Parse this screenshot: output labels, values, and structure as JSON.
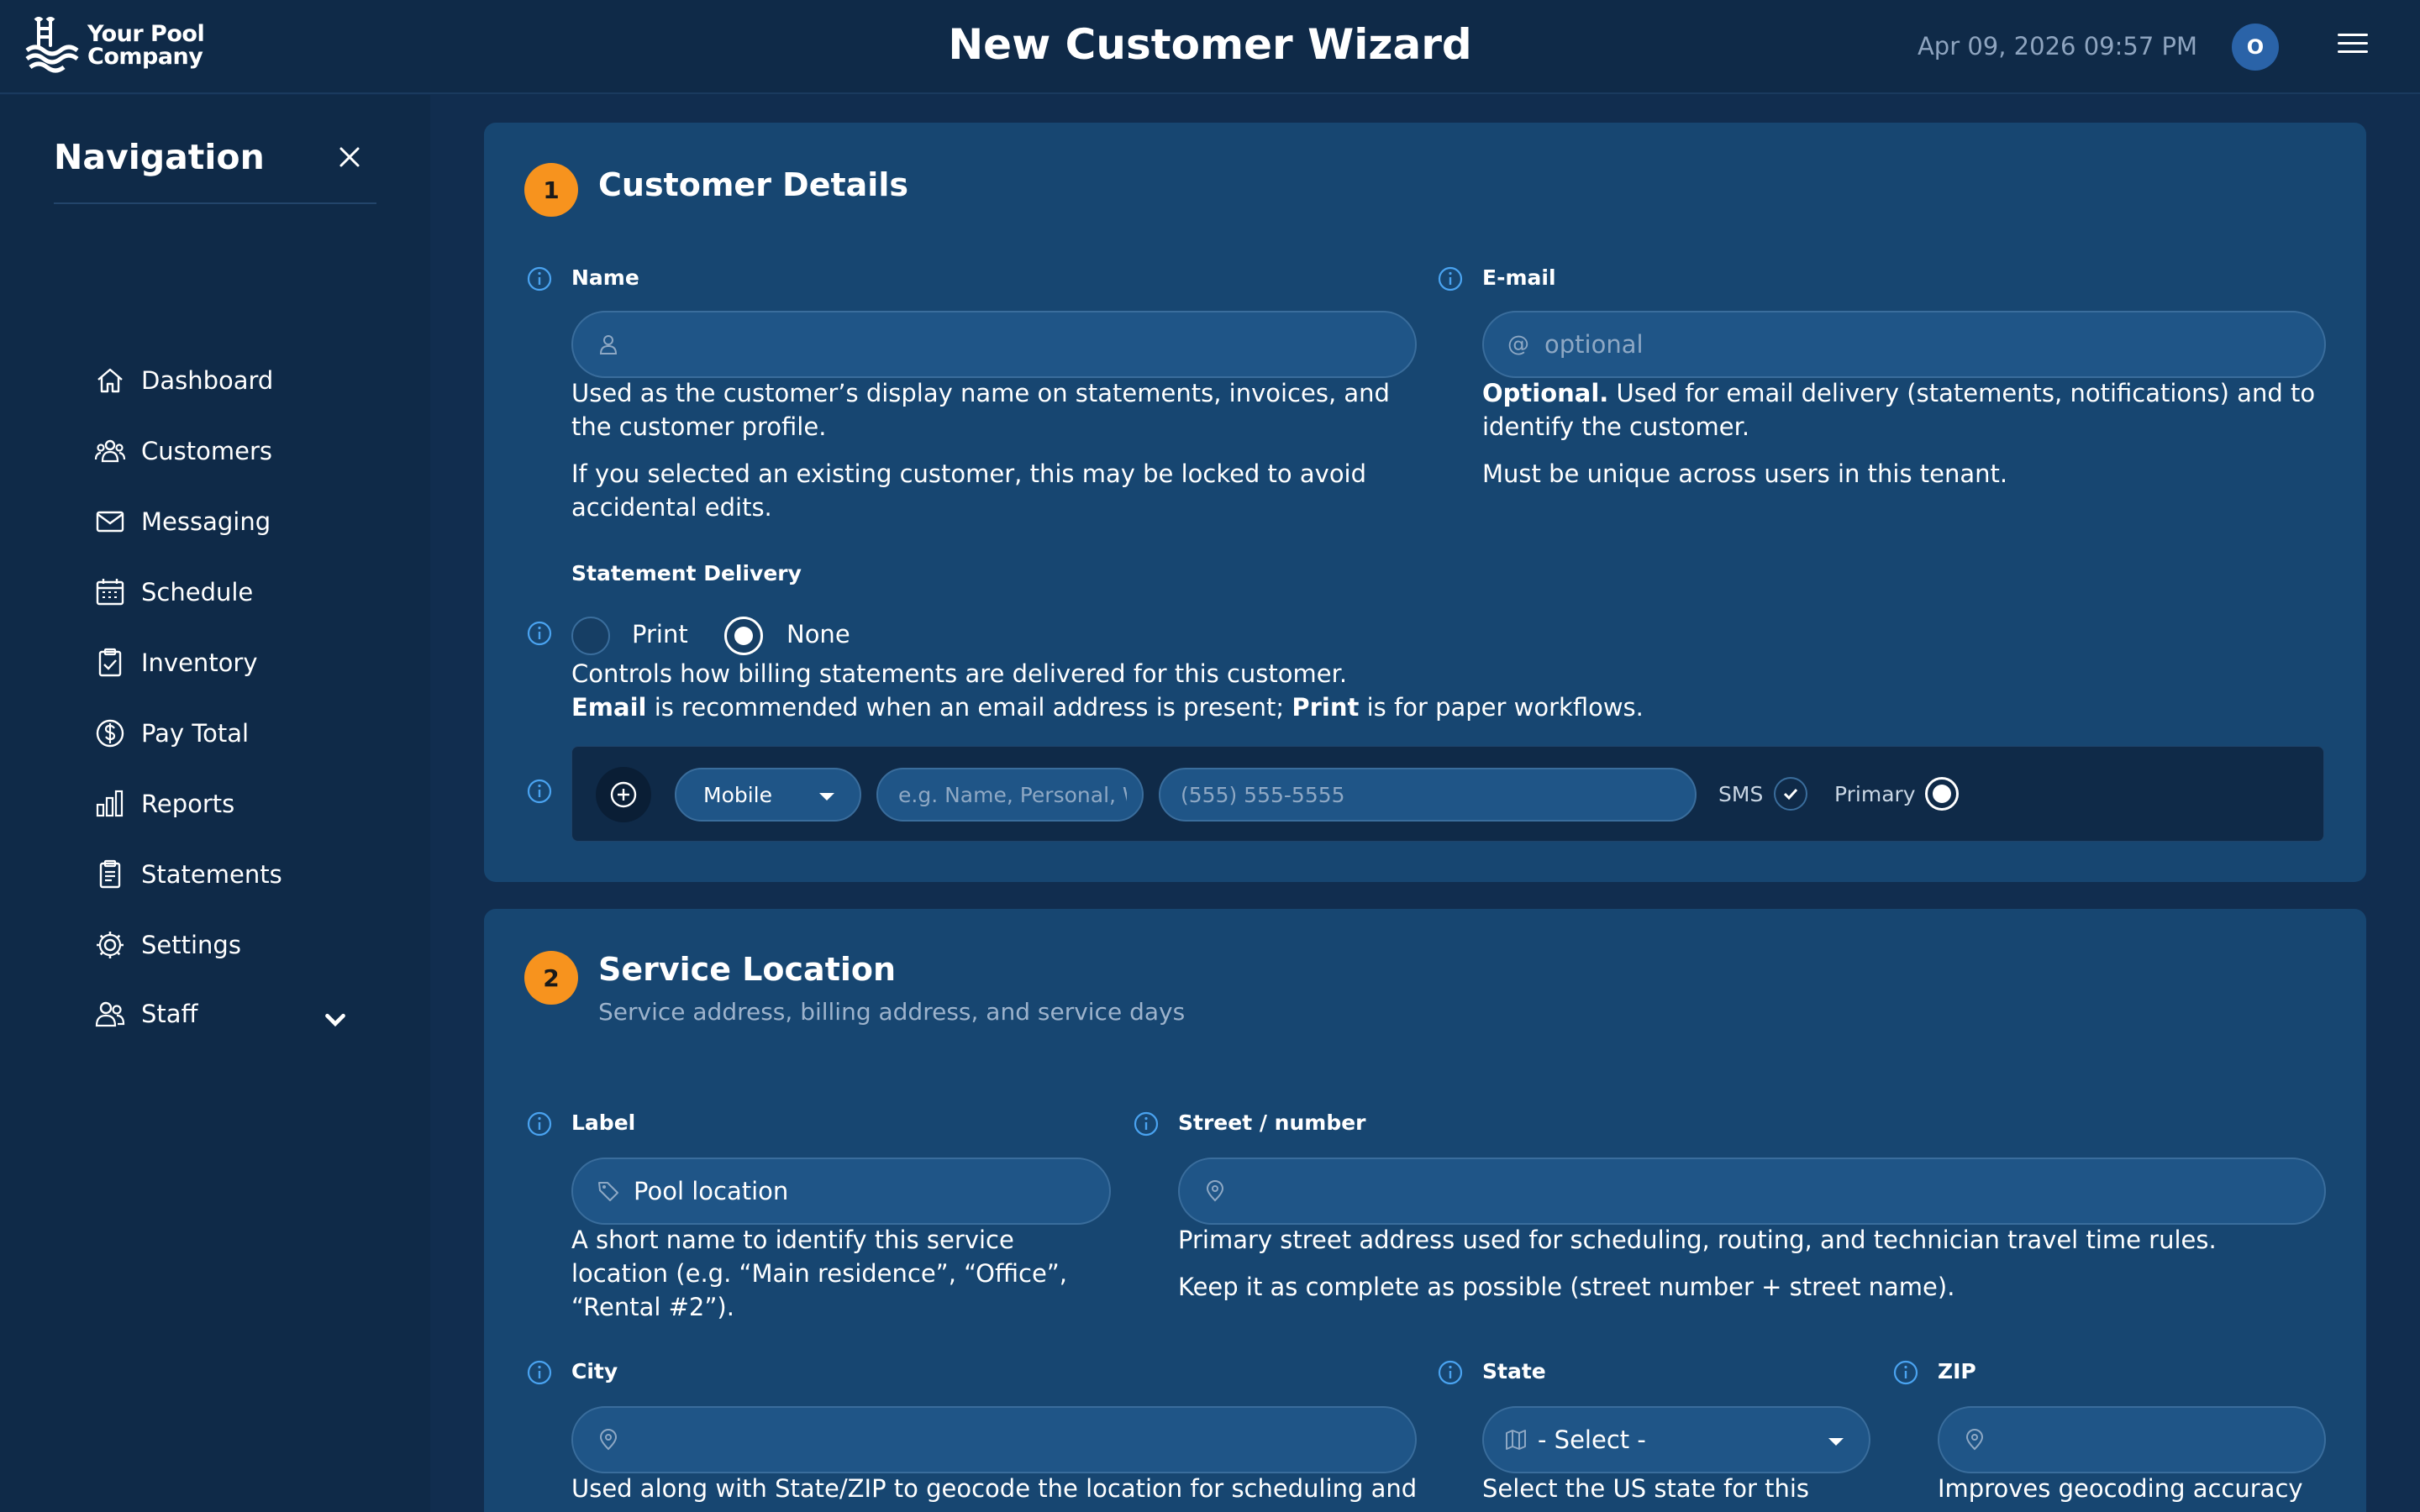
{
  "brand": {
    "name_line1": "Your Pool",
    "name_line2": "Company"
  },
  "header": {
    "title": "New Customer Wizard",
    "datetime": "Apr 09, 2026 09:57 PM",
    "avatar_initial": "O"
  },
  "sidebar": {
    "title": "Navigation",
    "items": [
      {
        "label": "Dashboard",
        "icon": "home-icon"
      },
      {
        "label": "Customers",
        "icon": "users-icon"
      },
      {
        "label": "Messaging",
        "icon": "envelope-icon"
      },
      {
        "label": "Schedule",
        "icon": "calendar-icon"
      },
      {
        "label": "Inventory",
        "icon": "clipboard-check-icon"
      },
      {
        "label": "Pay Total",
        "icon": "dollar-circle-icon"
      },
      {
        "label": "Reports",
        "icon": "bar-chart-icon"
      },
      {
        "label": "Statements",
        "icon": "document-icon"
      },
      {
        "label": "Settings",
        "icon": "gear-icon"
      },
      {
        "label": "Staff",
        "icon": "people-icon"
      }
    ]
  },
  "step1": {
    "number": "1",
    "title": "Customer Details",
    "name": {
      "label": "Name",
      "value": "",
      "help1": "Used as the customer’s display name on statements, invoices, and the customer profile.",
      "help2": "If you selected an existing customer, this may be locked to avoid accidental edits."
    },
    "email": {
      "label": "E-mail",
      "placeholder": "optional",
      "help_strong": "Optional.",
      "help1_rest": " Used for email delivery (statements, notifications) and to identify the customer.",
      "help2": "Must be unique across users in this tenant."
    },
    "delivery": {
      "label": "Statement Delivery",
      "options": [
        {
          "label": "Print",
          "selected": false
        },
        {
          "label": "None",
          "selected": true
        }
      ],
      "help1": "Controls how billing statements are delivered for this customer.",
      "help2_a": "Email",
      "help2_b": " is recommended when an email address is present; ",
      "help2_c": "Print",
      "help2_d": " is for paper workflows."
    },
    "phone": {
      "type": "Mobile",
      "label_placeholder": "e.g. Name, Personal, W",
      "number_placeholder": "(555) 555-5555",
      "sms_label": "SMS",
      "sms_checked": true,
      "primary_label": "Primary",
      "primary_selected": true
    }
  },
  "step2": {
    "number": "2",
    "title": "Service Location",
    "subtitle": "Service address, billing address, and service days",
    "label_field": {
      "label": "Label",
      "value": "Pool location",
      "help": "A short name to identify this service location (e.g. “Main residence”, “Office”, “Rental #2”)."
    },
    "street": {
      "label": "Street / number",
      "value": "",
      "help1": "Primary street address used for scheduling, routing, and technician travel time rules.",
      "help2": "Keep it as complete as possible (street number + street name)."
    },
    "city": {
      "label": "City",
      "value": "",
      "help": "Used along with State/ZIP to geocode the location for scheduling and"
    },
    "state": {
      "label": "State",
      "value": "- Select -",
      "help": "Select the US state for this"
    },
    "zip": {
      "label": "ZIP",
      "value": "",
      "help": "Improves geocoding accuracy"
    }
  },
  "colors": {
    "accent": "#f7931e",
    "background": "#112d4f",
    "card": "#174671",
    "sidebar": "#0f2a48",
    "info": "#4aa3f0"
  }
}
